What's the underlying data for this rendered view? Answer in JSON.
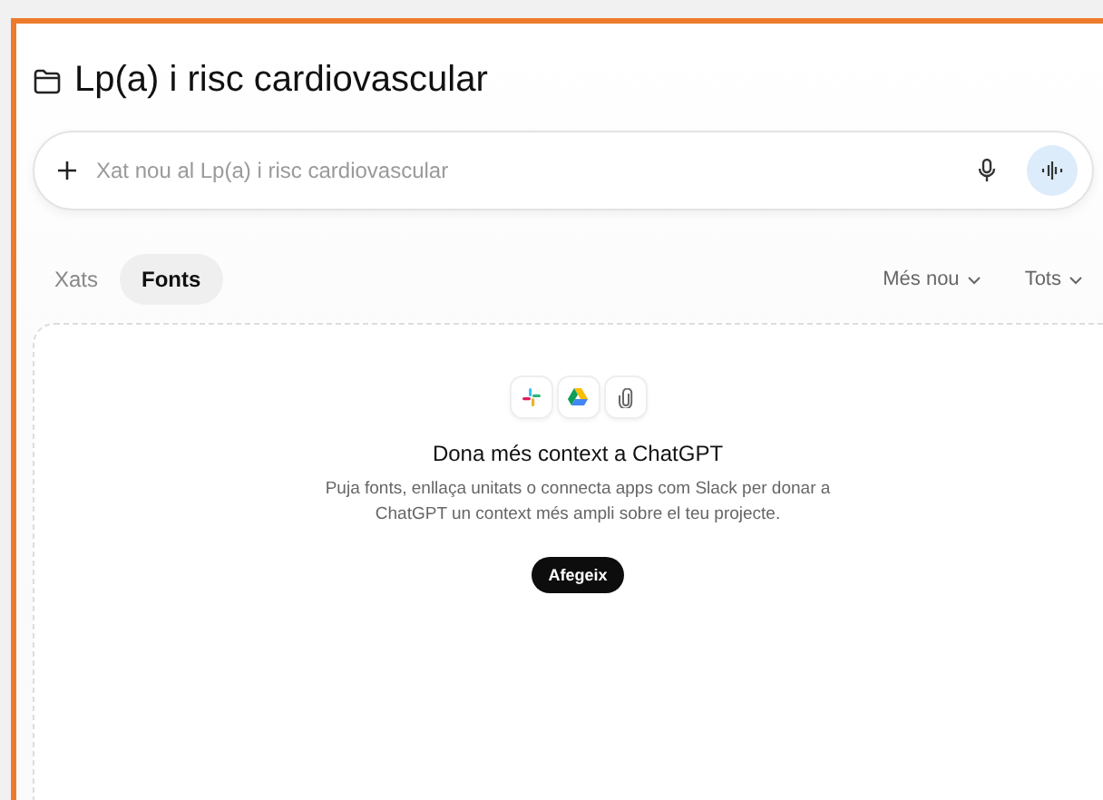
{
  "project": {
    "title": "Lp(a) i risc cardiovascular"
  },
  "composer": {
    "placeholder": "Xat nou al Lp(a) i risc cardiovascular"
  },
  "tabs": [
    {
      "label": "Xats",
      "selected": false
    },
    {
      "label": "Fonts",
      "selected": true
    }
  ],
  "filters": [
    "Més nou",
    "Tots"
  ],
  "empty_state": {
    "heading": "Dona més context a ChatGPT",
    "body": "Puja fonts, enllaça unitats o connecta apps com Slack per donar a ChatGPT un context més ampli sobre el teu projecte.",
    "button": "Afegeix"
  }
}
